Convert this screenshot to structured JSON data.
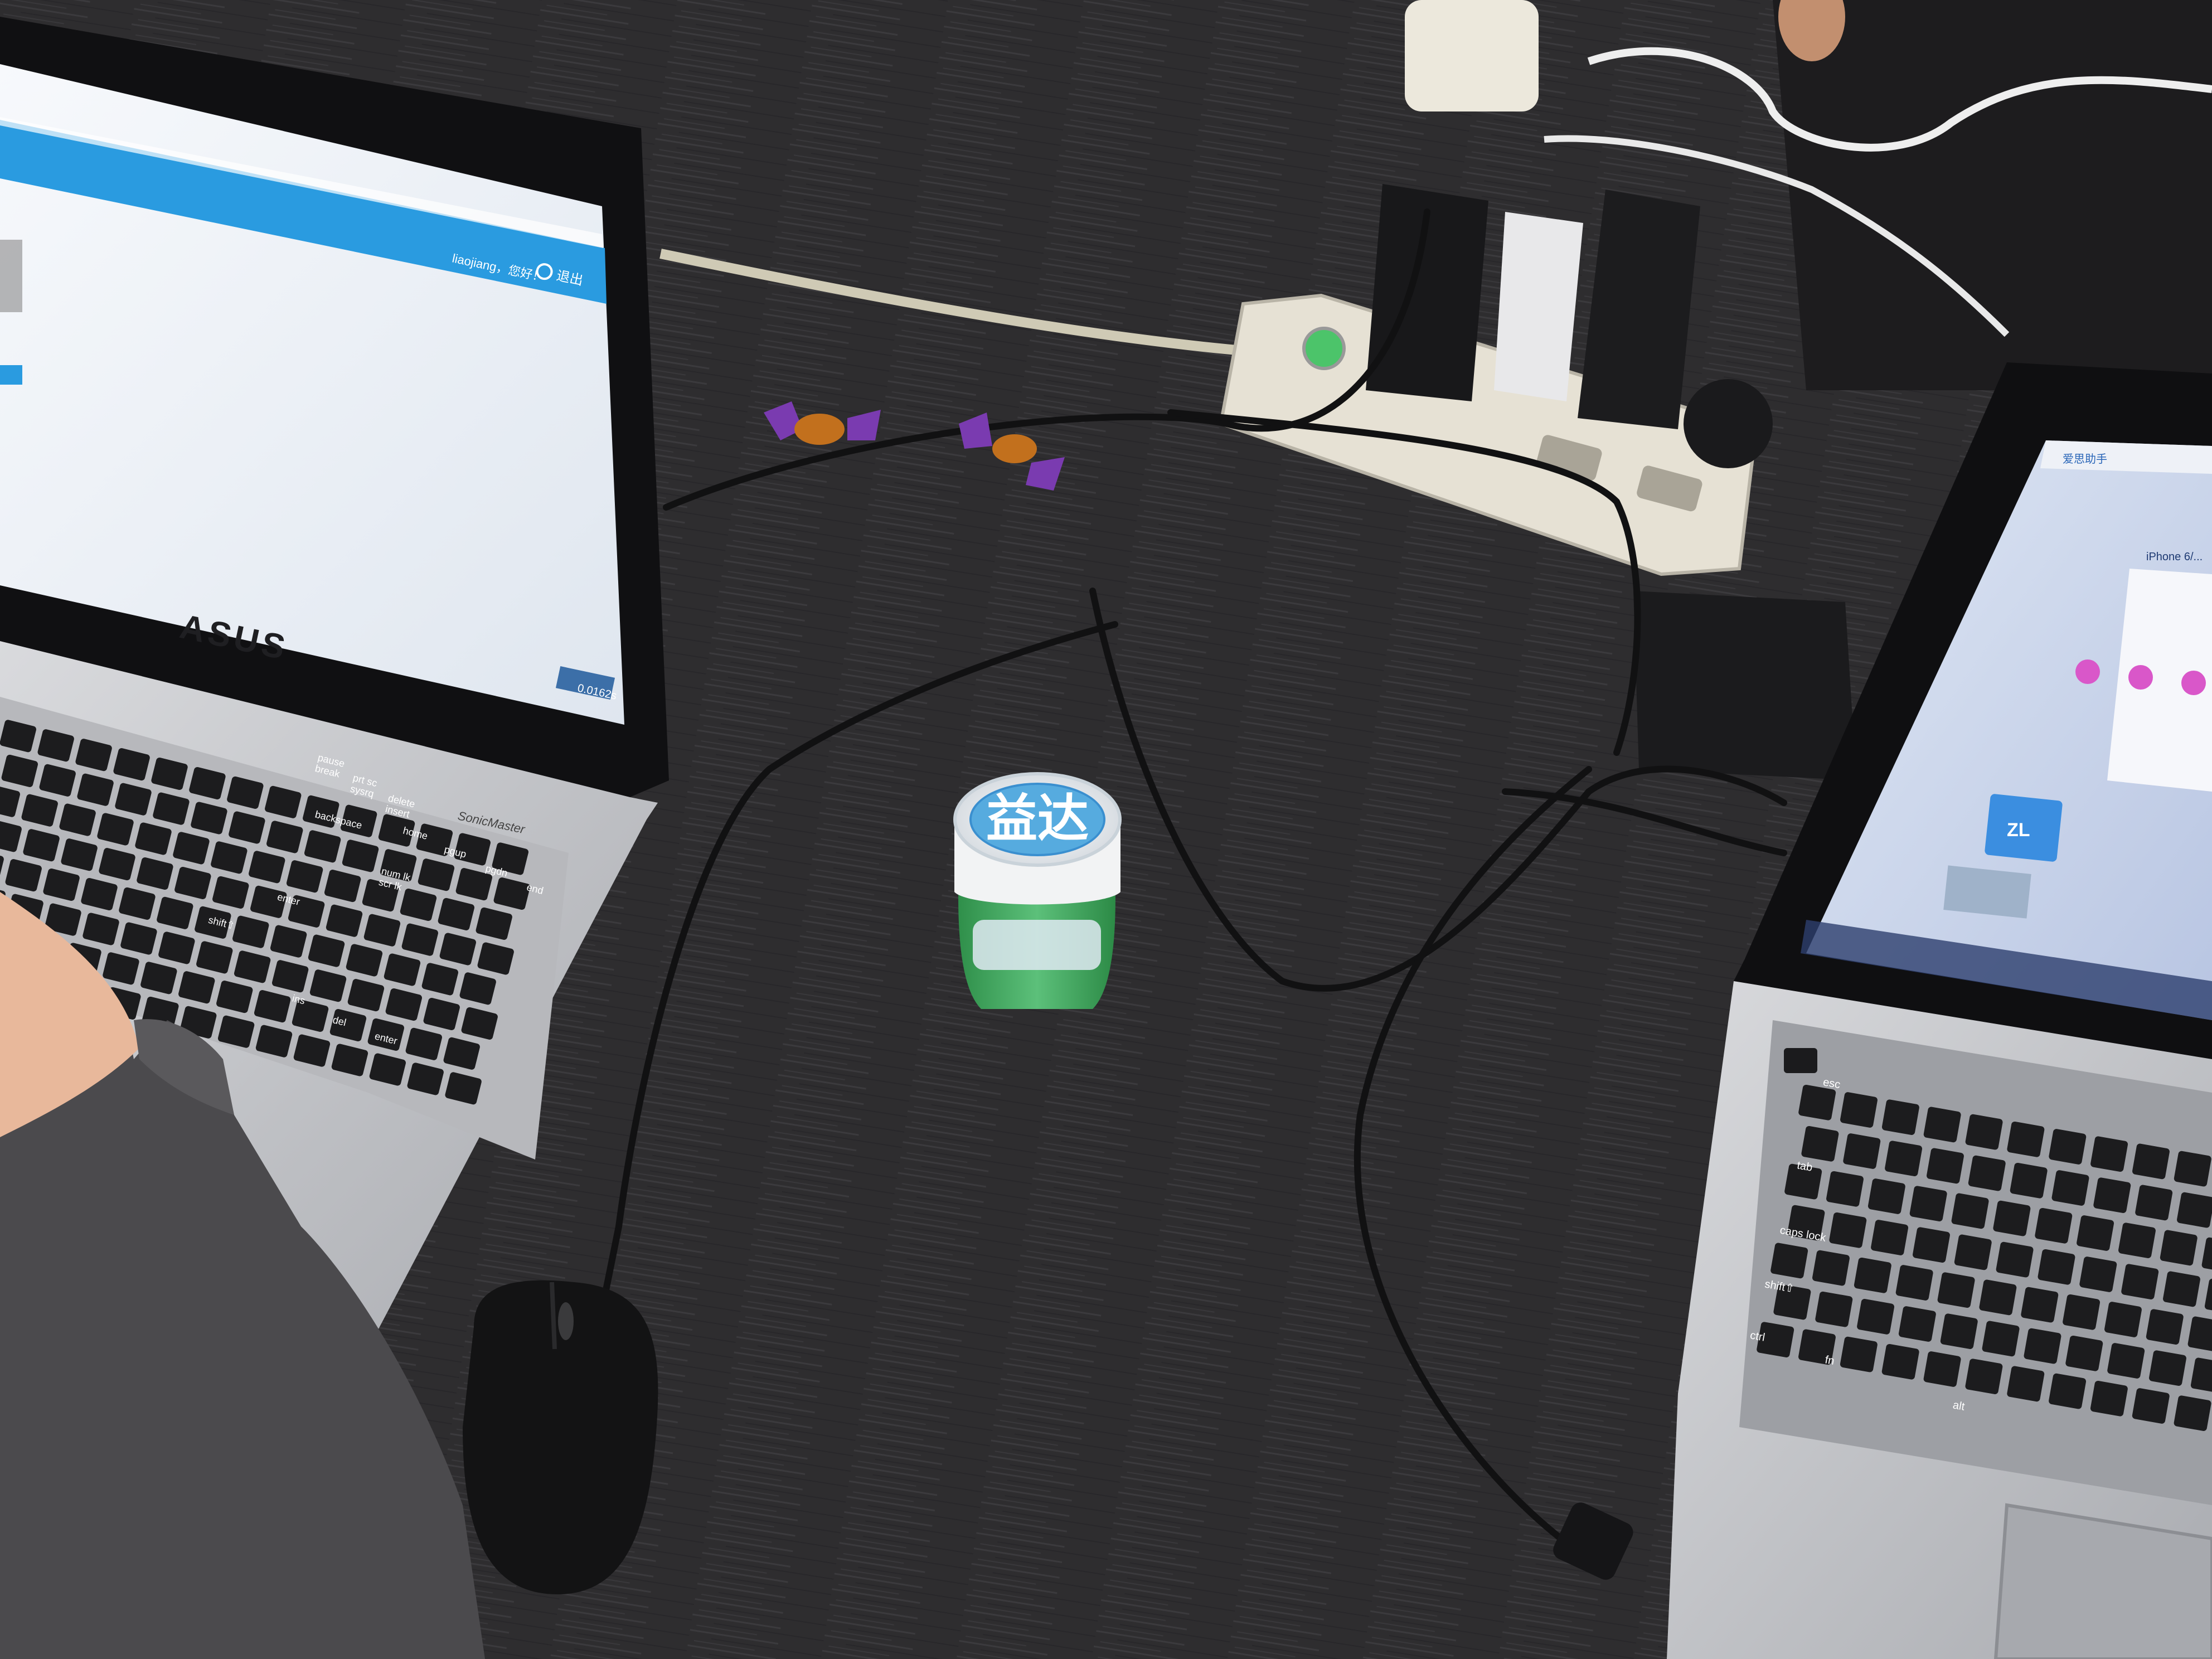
{
  "photo": {
    "subject": "Office desk with two laptops, a gum bottle, mouse and a power strip",
    "colors": {
      "desk": "#2e2d2f",
      "desk_grain": "#3c3b3e",
      "laptop_silver": "#c9cacd",
      "screen_bg": "#eef3f9",
      "accent_blue": "#2a9be0",
      "gum_green": "#3aa35a",
      "power_strip": "#e6e1d4",
      "cable": "#111112",
      "candy_purple": "#7a3bb0"
    }
  },
  "left_laptop": {
    "brand": "ASUS",
    "badge": "SonicMaster",
    "screen": {
      "user_text": "liaojiang，您好！",
      "logout_label": "退出",
      "status_text": "0.0162s"
    },
    "keys": {
      "pause": "pause",
      "break": "break",
      "prt_sc": "prt sc",
      "sysrq": "sysrq",
      "delete": "delete",
      "insert": "insert",
      "backspace": "backspace",
      "home": "home",
      "pgup": "pgup",
      "pgdn": "pgdn",
      "end": "end",
      "num_lk": "num lk",
      "scr_lk": "scr lk",
      "enter": "enter",
      "shift": "shift⇧",
      "ins": "ins",
      "del": "del"
    }
  },
  "right_laptop": {
    "screen": {
      "app_title": "爱思助手",
      "device_label": "iPhone 6/...",
      "tile_label": "ZL"
    },
    "keys": {
      "esc": "esc",
      "tab": "tab",
      "caps_lock": "caps lock",
      "shift": "shift⇧",
      "ctrl": "ctrl",
      "fn": "fn",
      "alt": "alt"
    }
  },
  "gum_bottle": {
    "brand": "益达"
  }
}
